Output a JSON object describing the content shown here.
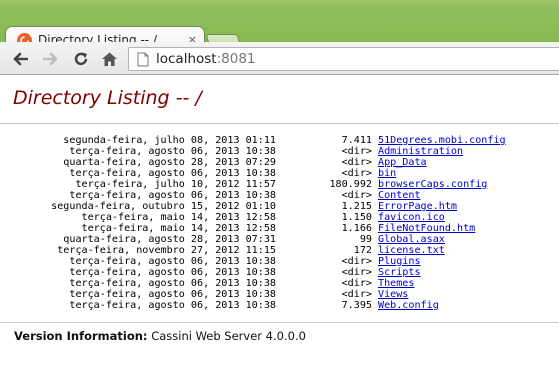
{
  "browser": {
    "tab": {
      "title": "Directory Listing -- /",
      "close_glyph": "×",
      "favicon": "cassini-favicon-icon"
    },
    "url": {
      "host": "localhost",
      "port": ":8081"
    },
    "icons": [
      "back-arrow-icon",
      "forward-arrow-icon",
      "reload-icon",
      "home-icon",
      "page-icon"
    ]
  },
  "page": {
    "heading": "Directory Listing -- /",
    "entries": [
      {
        "date": "segunda-feira, julho 08, 2013 01:11",
        "size": "7.411",
        "name": "51Degrees.mobi.config"
      },
      {
        "date": "terça-feira, agosto 06, 2013 10:38",
        "size": "<dir>",
        "name": "Administration"
      },
      {
        "date": "quarta-feira, agosto 28, 2013 07:29",
        "size": "<dir>",
        "name": "App_Data"
      },
      {
        "date": "terça-feira, agosto 06, 2013 10:38",
        "size": "<dir>",
        "name": "bin"
      },
      {
        "date": "terça-feira, julho 10, 2012 11:57",
        "size": "180.992",
        "name": "browserCaps.config"
      },
      {
        "date": "terça-feira, agosto 06, 2013 10:38",
        "size": "<dir>",
        "name": "Content"
      },
      {
        "date": "segunda-feira, outubro 15, 2012 01:10",
        "size": "1.215",
        "name": "ErrorPage.htm"
      },
      {
        "date": "terça-feira, maio 14, 2013 12:58",
        "size": "1.150",
        "name": "favicon.ico"
      },
      {
        "date": "terça-feira, maio 14, 2013 12:58",
        "size": "1.166",
        "name": "FileNotFound.htm"
      },
      {
        "date": "quarta-feira, agosto 28, 2013 07:31",
        "size": "99",
        "name": "Global.asax"
      },
      {
        "date": "terça-feira, novembro 27, 2012 11:15",
        "size": "172",
        "name": "license.txt"
      },
      {
        "date": "terça-feira, agosto 06, 2013 10:38",
        "size": "<dir>",
        "name": "Plugins"
      },
      {
        "date": "terça-feira, agosto 06, 2013 10:38",
        "size": "<dir>",
        "name": "Scripts"
      },
      {
        "date": "terça-feira, agosto 06, 2013 10:38",
        "size": "<dir>",
        "name": "Themes"
      },
      {
        "date": "terça-feira, agosto 06, 2013 10:38",
        "size": "<dir>",
        "name": "Views"
      },
      {
        "date": "terça-feira, agosto 06, 2013 10:38",
        "size": "7.395",
        "name": "Web.config"
      }
    ],
    "version": {
      "label": "Version Information:",
      "value": "Cassini Web Server 4.0.0.0"
    }
  },
  "colors": {
    "heading": "#800000",
    "link": "#0000cc",
    "frame": "#8cbc59"
  }
}
